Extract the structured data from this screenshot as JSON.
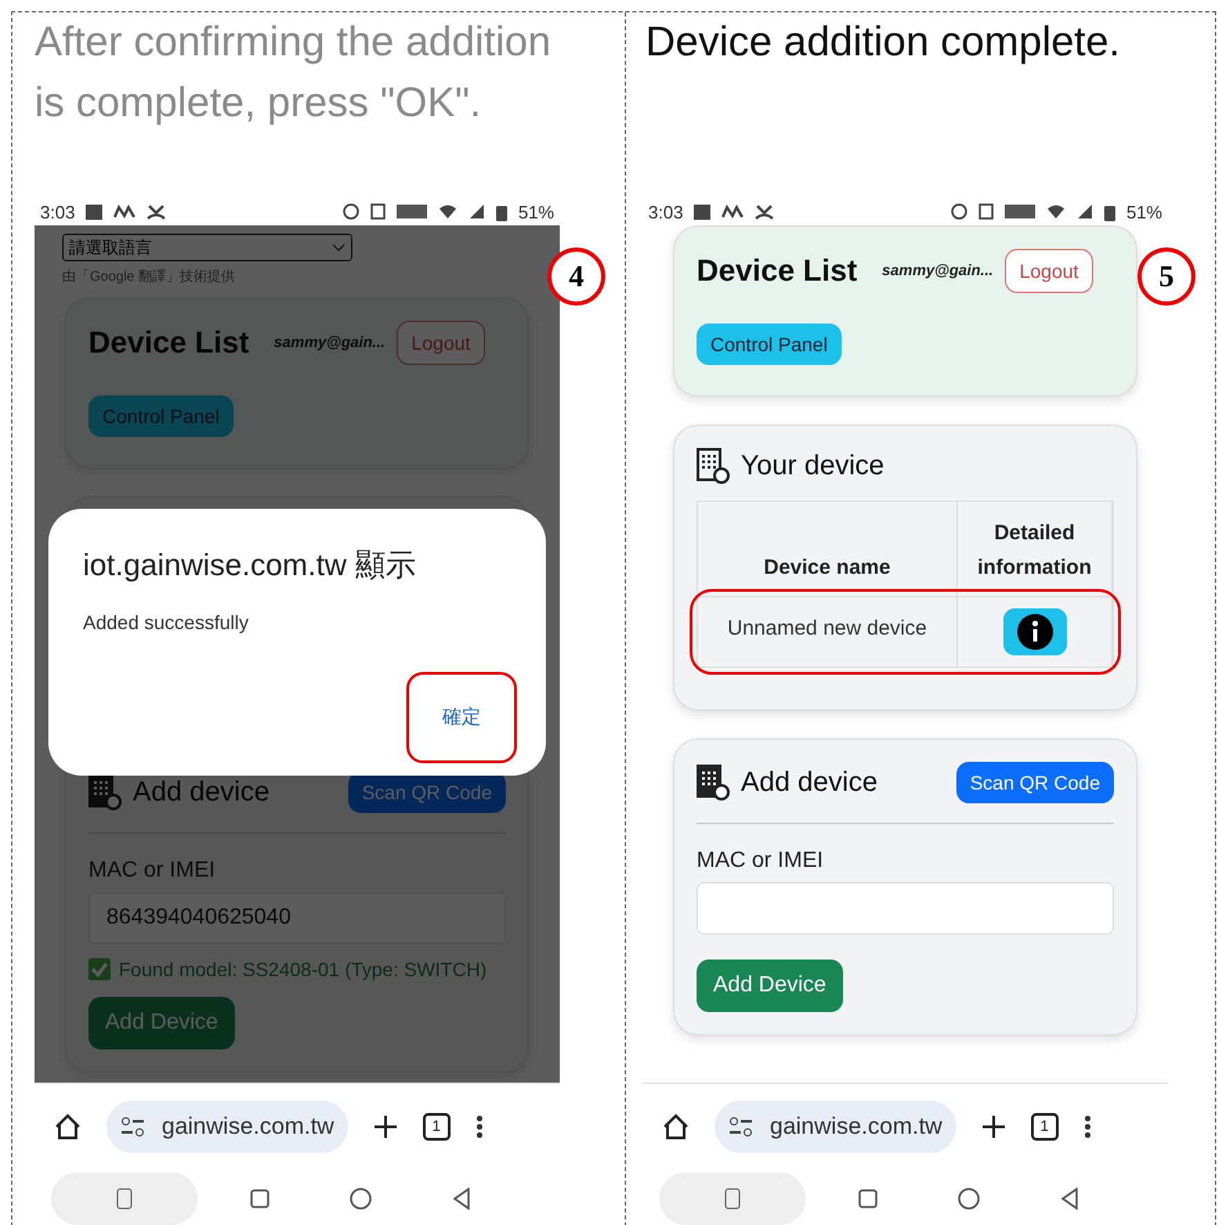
{
  "panels": [
    {
      "caption": "After confirming the addition is complete, press \"OK\".",
      "caption_muted": true,
      "step": "4",
      "phone": {
        "status_time": "3:03",
        "battery": "51%",
        "translate": {
          "select": "請選取語言",
          "credit": "由「Google 翻譯」技術提供"
        },
        "header": {
          "title": "Device List",
          "user": "sammy@gain...",
          "logout": "Logout",
          "control_panel": "Control Panel"
        },
        "dimmed": true,
        "dialog": {
          "title": "iot.gainwise.com.tw 顯示",
          "message": "Added successfully",
          "ok": "確定",
          "ok_highlighted": true
        },
        "add": {
          "title": "Add device",
          "scan": "Scan QR Code",
          "label": "MAC or IMEI",
          "value": "864394040625040",
          "found": "Found model: SS2408-01 (Type: SWITCH)",
          "button": "Add Device"
        },
        "browser": {
          "url": "gainwise.com.tw",
          "tabs": "1"
        }
      }
    },
    {
      "caption": "Device addition complete.",
      "caption_muted": false,
      "step": "5",
      "phone": {
        "status_time": "3:03",
        "battery": "51%",
        "header": {
          "title": "Device List",
          "user": "sammy@gain...",
          "logout": "Logout",
          "control_panel": "Control Panel"
        },
        "dimmed": false,
        "devices": {
          "title": "Your device",
          "columns": [
            "Device name",
            "Detailed information"
          ],
          "rows": [
            {
              "name": "Unnamed new device",
              "highlighted": true
            }
          ]
        },
        "add": {
          "title": "Add device",
          "scan": "Scan QR Code",
          "label": "MAC or IMEI",
          "button": "Add Device"
        },
        "browser": {
          "url": "gainwise.com.tw",
          "tabs": "1"
        }
      }
    }
  ]
}
